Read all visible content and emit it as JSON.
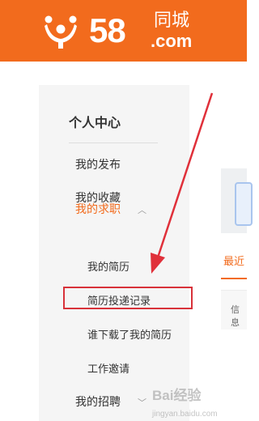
{
  "header": {
    "logo_number": "58",
    "logo_chinese": "同城",
    "logo_suffix": ".com"
  },
  "sidebar": {
    "title": "个人中心",
    "items": [
      {
        "label": "我的发布"
      },
      {
        "label": "我的收藏"
      },
      {
        "label": "我的求职",
        "expanded": true
      },
      {
        "label": "我的招聘",
        "expanded": false
      }
    ],
    "sub_items": [
      {
        "label": "我的简历"
      },
      {
        "label": "简历投递记录",
        "highlighted": true
      },
      {
        "label": "谁下载了我的简历"
      },
      {
        "label": "工作邀请"
      }
    ]
  },
  "content": {
    "tab_label": "最近",
    "table_header_label": "信息"
  },
  "watermark": {
    "text": "Bai",
    "text2": "经验",
    "subtext": "jingyan.baidu.com"
  },
  "colors": {
    "brand": "#f26b1d",
    "highlight": "#d8323a",
    "arrow": "#e0303a"
  }
}
